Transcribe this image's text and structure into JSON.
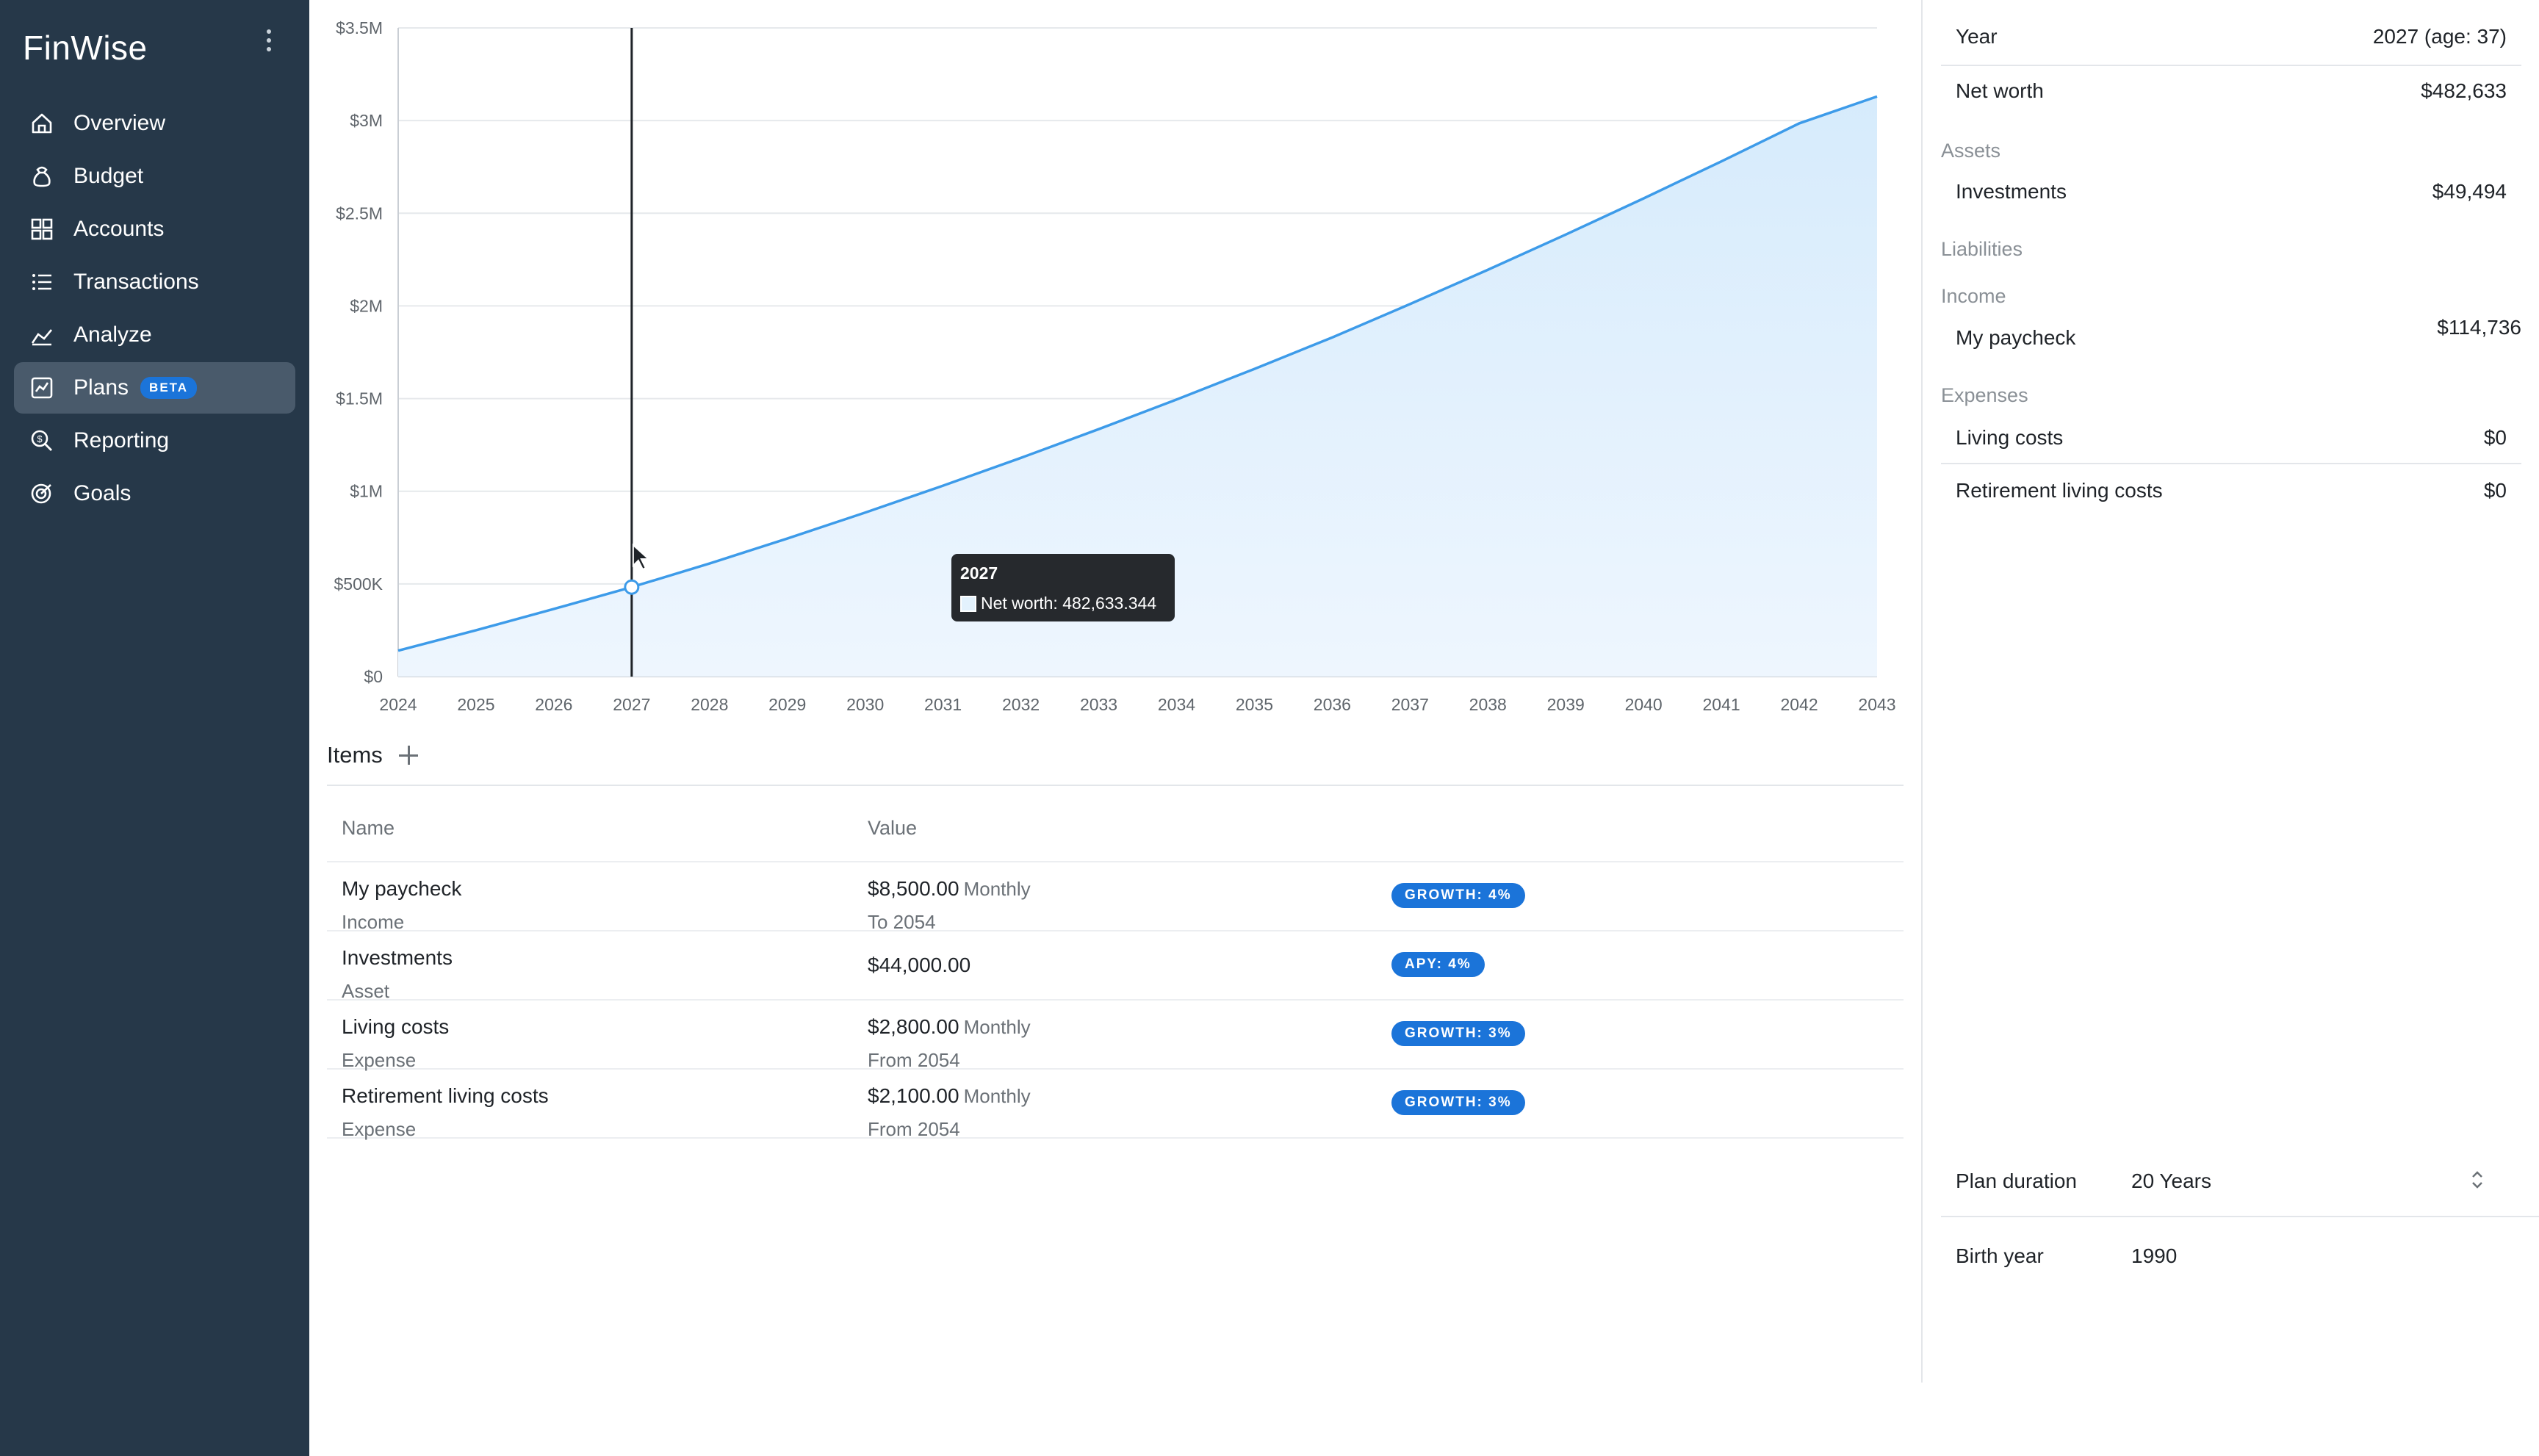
{
  "app": {
    "brand": "FinWise"
  },
  "nav": [
    {
      "label": "Overview",
      "icon": "home-icon"
    },
    {
      "label": "Budget",
      "icon": "budget-bag-icon"
    },
    {
      "label": "Accounts",
      "icon": "grid-icon"
    },
    {
      "label": "Transactions",
      "icon": "list-icon"
    },
    {
      "label": "Analyze",
      "icon": "area-chart-icon"
    },
    {
      "label": "Plans",
      "icon": "line-chart-icon",
      "badge": "BETA",
      "active": true
    },
    {
      "label": "Reporting",
      "icon": "search-report-icon"
    },
    {
      "label": "Goals",
      "icon": "target-icon"
    }
  ],
  "chart_data": {
    "type": "area",
    "title": "",
    "xlabel": "",
    "ylabel": "",
    "x": [
      2024,
      2025,
      2026,
      2027,
      2028,
      2029,
      2030,
      2031,
      2032,
      2033,
      2034,
      2035,
      2036,
      2037,
      2038,
      2039,
      2040,
      2041,
      2042,
      2043
    ],
    "series": [
      {
        "name": "Net worth",
        "values": [
          140000,
          250000,
          365000,
          482633,
          610000,
          745000,
          885000,
          1030000,
          1180000,
          1335000,
          1495000,
          1660000,
          1830000,
          2010000,
          2195000,
          2385000,
          2580000,
          2780000,
          2985000,
          3130000
        ],
        "color": "#3d9be9"
      }
    ],
    "ylim": [
      0,
      3500000
    ],
    "yticks": [
      0,
      500000,
      1000000,
      1500000,
      2000000,
      2500000,
      3000000,
      3500000
    ],
    "ytick_labels": [
      "$0",
      "$500K",
      "$1M",
      "$1.5M",
      "$2M",
      "$2.5M",
      "$3M",
      "$3.5M"
    ],
    "grid": true,
    "cursor_x": 2027,
    "tooltip": {
      "year": "2027",
      "label": "Net worth: 482,633.344"
    }
  },
  "items": {
    "title": "Items",
    "columns": {
      "name": "Name",
      "value": "Value"
    },
    "rows": [
      {
        "name": "My paycheck",
        "type": "Income",
        "value": "$8,500.00",
        "freq": "Monthly",
        "sub": "To 2054",
        "pill": "GROWTH: 4%"
      },
      {
        "name": "Investments",
        "type": "Asset",
        "value": "$44,000.00",
        "freq": "",
        "sub": "",
        "pill": "APY: 4%"
      },
      {
        "name": "Living costs",
        "type": "Expense",
        "value": "$2,800.00",
        "freq": "Monthly",
        "sub": "From 2054",
        "pill": "GROWTH: 3%"
      },
      {
        "name": "Retirement living costs",
        "type": "Expense",
        "value": "$2,100.00",
        "freq": "Monthly",
        "sub": "From 2054",
        "pill": "GROWTH: 3%"
      }
    ]
  },
  "summary": {
    "year_label": "Year",
    "year_value": "2027 (age: 37)",
    "networth_label": "Net worth",
    "networth_value": "$482,633",
    "assets_label": "Assets",
    "investments_label": "Investments",
    "investments_value": "$49,494",
    "liabilities_label": "Liabilities",
    "income_label": "Income",
    "paycheck_label": "My paycheck",
    "paycheck_value": "$114,736",
    "expenses_label": "Expenses",
    "living_label": "Living costs",
    "living_value": "$0",
    "retirement_label": "Retirement living costs",
    "retirement_value": "$0"
  },
  "settings": {
    "duration_label": "Plan duration",
    "duration_value": "20 Years",
    "birth_label": "Birth year",
    "birth_value": "1990"
  }
}
